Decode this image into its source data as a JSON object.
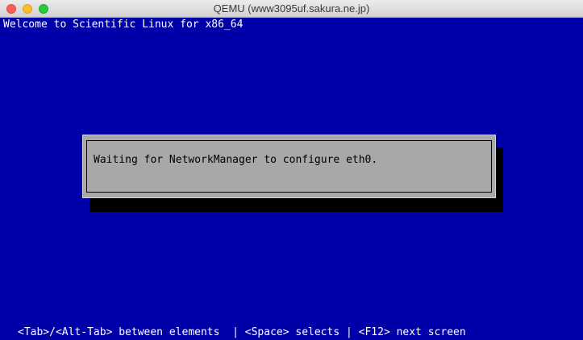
{
  "window": {
    "title": "QEMU (www3095uf.sakura.ne.jp)",
    "colors": {
      "close": "#fc5f57",
      "minimize": "#fdbc2e",
      "maximize": "#29c840"
    }
  },
  "screen": {
    "background": "#0000a8",
    "welcome": "Welcome to Scientific Linux for x86_64",
    "dialog": {
      "message": "Waiting for NetworkManager to configure eth0."
    },
    "help_line": "<Tab>/<Alt-Tab> between elements  | <Space> selects | <F12> next screen"
  }
}
